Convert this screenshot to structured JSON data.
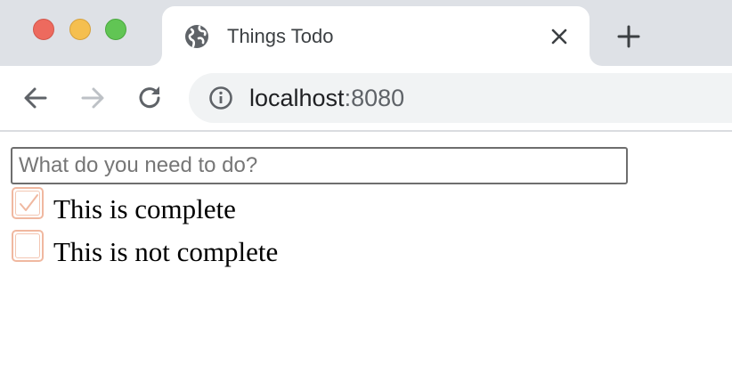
{
  "browser": {
    "tab": {
      "title": "Things Todo",
      "favicon": "globe-icon"
    },
    "address_bar": {
      "host": "localhost",
      "port": ":8080"
    },
    "icons": {
      "close_tab": "close-icon",
      "new_tab": "plus-icon",
      "back": "back-arrow-icon",
      "forward": "forward-arrow-icon",
      "reload": "reload-icon",
      "site_info": "info-icon"
    },
    "colors": {
      "tab_strip": "#dee1e6",
      "omnibox": "#f1f3f4",
      "window_close": "#ed6a5e",
      "window_minimize": "#f5bf4f",
      "window_maximize": "#61c554",
      "checkbox_border": "#f0b8a0"
    }
  },
  "todo": {
    "input": {
      "placeholder": "What do you need to do?",
      "value": ""
    },
    "items": [
      {
        "label": "This is complete",
        "completed": true
      },
      {
        "label": "This is not complete",
        "completed": false
      }
    ]
  }
}
